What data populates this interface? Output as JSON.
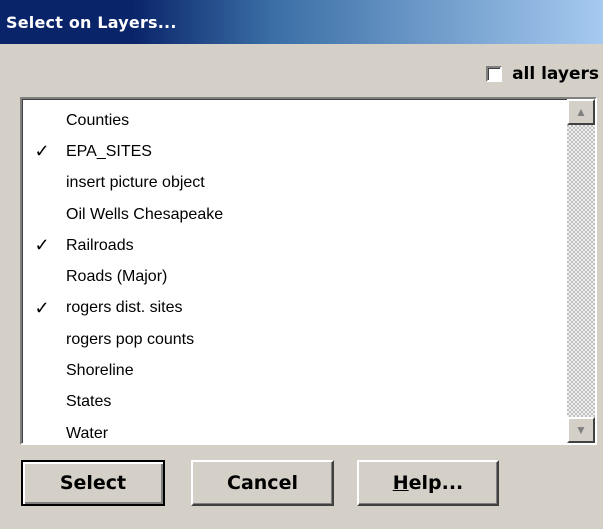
{
  "window": {
    "title": "Select on Layers..."
  },
  "all_layers": {
    "label": "all layers",
    "checked": false
  },
  "layers": [
    {
      "label": "Counties",
      "checked": false
    },
    {
      "label": "EPA_SITES",
      "checked": true
    },
    {
      "label": "insert picture object",
      "checked": false
    },
    {
      "label": "Oil Wells Chesapeake",
      "checked": false
    },
    {
      "label": "Railroads",
      "checked": true
    },
    {
      "label": "Roads (Major)",
      "checked": false
    },
    {
      "label": "rogers dist. sites",
      "checked": true
    },
    {
      "label": "rogers pop counts",
      "checked": false
    },
    {
      "label": "Shoreline",
      "checked": false
    },
    {
      "label": "States",
      "checked": false
    },
    {
      "label": "Water",
      "checked": false
    }
  ],
  "check_glyph": "✓",
  "scrollbar": {
    "up_icon": "▲",
    "down_icon": "▼"
  },
  "buttons": {
    "select": "Select",
    "cancel": "Cancel",
    "help_underlined": "H",
    "help_rest": "elp..."
  }
}
